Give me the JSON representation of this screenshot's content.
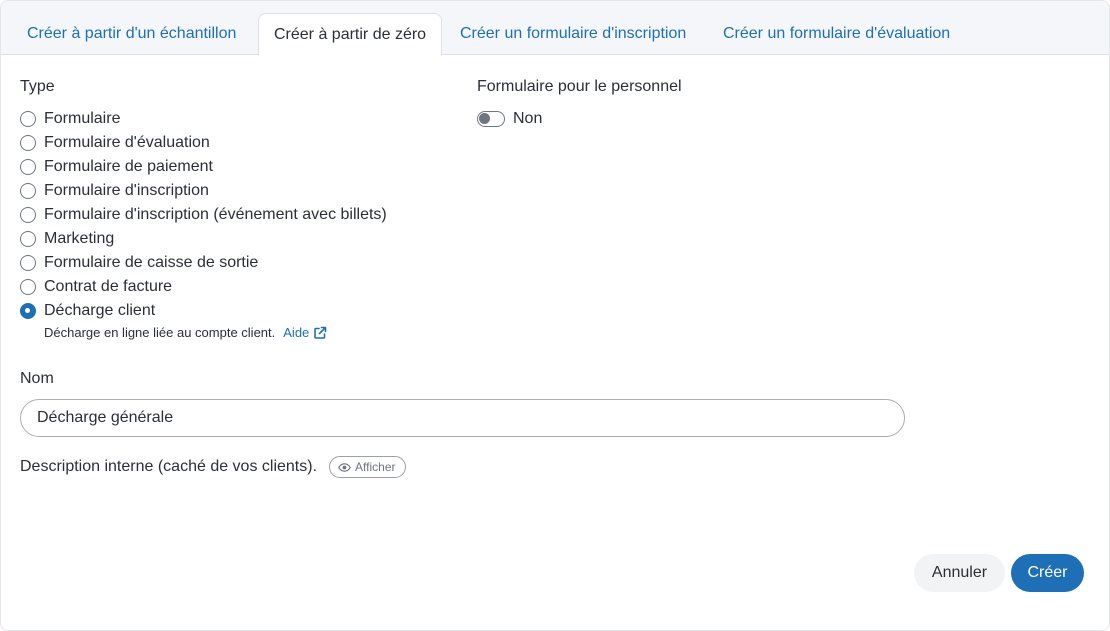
{
  "tabs": [
    {
      "label": "Créer à partir d'un échantillon",
      "active": false
    },
    {
      "label": "Créer à partir de zéro",
      "active": true
    },
    {
      "label": "Créer un formulaire d'inscription",
      "active": false
    },
    {
      "label": "Créer un formulaire d'évaluation",
      "active": false
    }
  ],
  "type_section": {
    "label": "Type",
    "options": [
      {
        "label": "Formulaire",
        "checked": false
      },
      {
        "label": "Formulaire d'évaluation",
        "checked": false
      },
      {
        "label": "Formulaire de paiement",
        "checked": false
      },
      {
        "label": "Formulaire d'inscription",
        "checked": false
      },
      {
        "label": "Formulaire d'inscription (événement avec billets)",
        "checked": false
      },
      {
        "label": "Marketing",
        "checked": false
      },
      {
        "label": "Formulaire de caisse de sortie",
        "checked": false
      },
      {
        "label": "Contrat de facture",
        "checked": false
      },
      {
        "label": "Décharge client",
        "checked": true
      }
    ],
    "hint": "Décharge en ligne liée au compte client.",
    "help_link": "Aide"
  },
  "staff_form": {
    "label": "Formulaire pour le personnel",
    "toggle_value": "Non"
  },
  "name_field": {
    "label": "Nom",
    "value": "Décharge générale"
  },
  "description": {
    "label": "Description interne (caché de vos clients).",
    "show_button": "Afficher"
  },
  "footer": {
    "cancel_label": "Annuler",
    "create_label": "Créer"
  },
  "colors": {
    "accent": "#1e6fb5",
    "text": "#2b2f36",
    "tabbar_bg": "#f4f6f9"
  }
}
